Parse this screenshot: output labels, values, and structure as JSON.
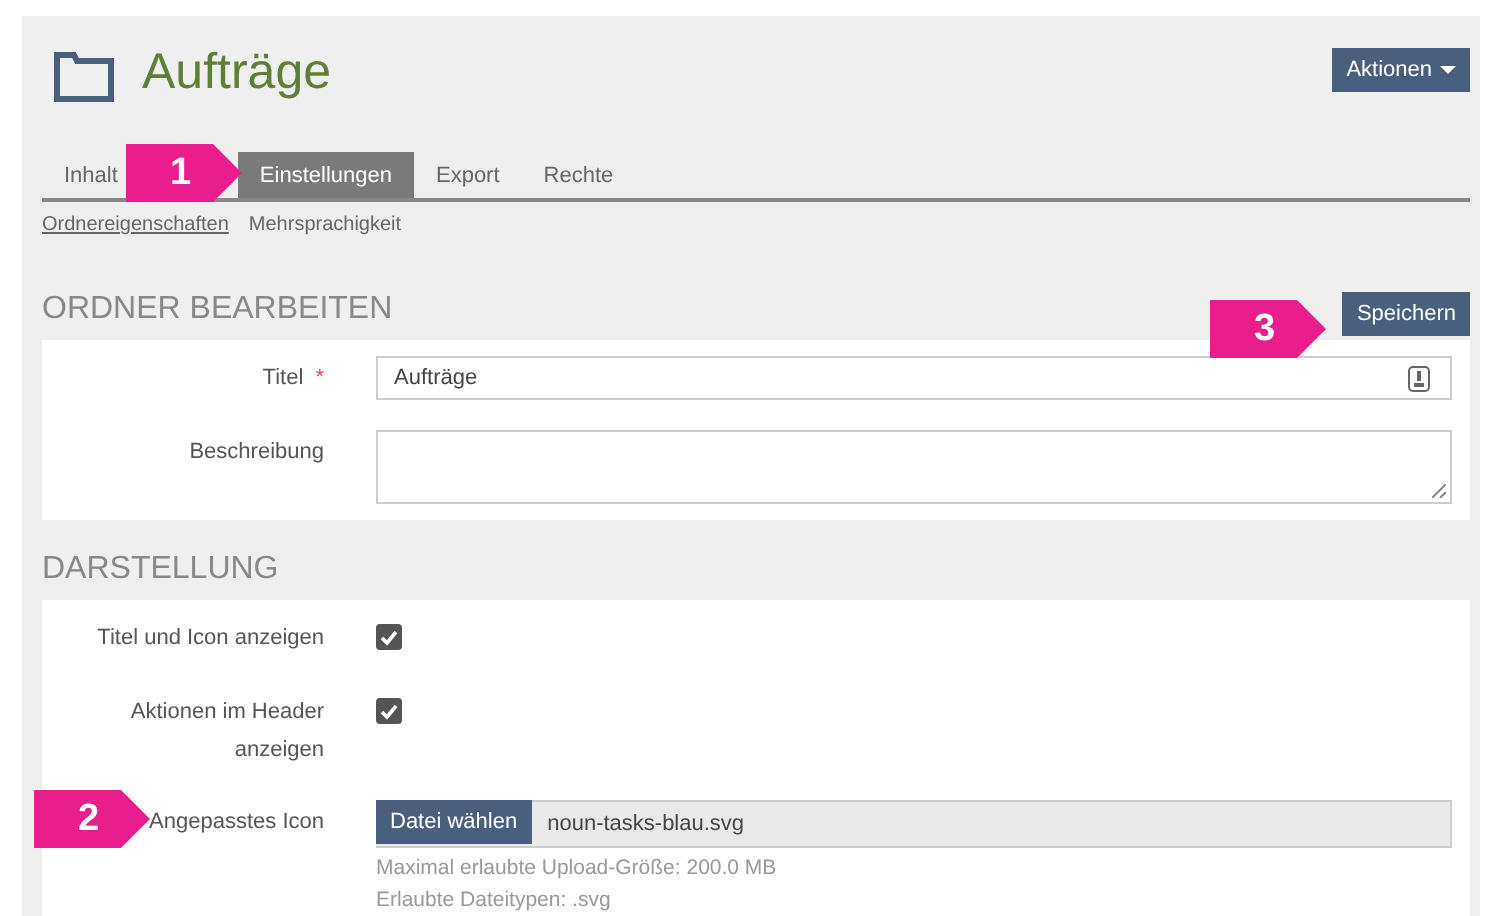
{
  "header": {
    "title": "Aufträge",
    "actions_button": "Aktionen"
  },
  "tabs": [
    {
      "label": "Inhalt",
      "selected": false
    },
    {
      "label": "Einstellungen",
      "selected": true
    },
    {
      "label": "Export",
      "selected": false
    },
    {
      "label": "Rechte",
      "selected": false
    }
  ],
  "subtabs": [
    {
      "label": "Ordnereigenschaften",
      "selected": true
    },
    {
      "label": "Mehrsprachigkeit",
      "selected": false
    }
  ],
  "sections": [
    {
      "title": "ORDNER BEARBEITEN",
      "save_button": "Speichern",
      "fields": [
        {
          "kind": "text",
          "label": "Titel",
          "required": true,
          "required_mark": "*",
          "value": "Aufträge"
        },
        {
          "kind": "textarea",
          "label": "Beschreibung",
          "required": false
        }
      ]
    },
    {
      "title": "DARSTELLUNG",
      "fields": [
        {
          "kind": "checkbox",
          "label": "Titel und Icon anzeigen",
          "required": false,
          "checked": true
        },
        {
          "kind": "checkbox",
          "label": "Aktionen im Header anzeigen",
          "required": false,
          "checked": true
        },
        {
          "kind": "file",
          "label": "Angepasstes Icon",
          "required": false,
          "button": "Datei wählen",
          "value": "noun-tasks-blau.svg",
          "help": [
            "Maximal erlaubte Upload-Größe: 200.0 MB",
            "Erlaubte Dateitypen: .svg"
          ]
        }
      ]
    }
  ],
  "callouts": [
    {
      "label": "1"
    },
    {
      "label": "3"
    },
    {
      "label": "2"
    }
  ]
}
